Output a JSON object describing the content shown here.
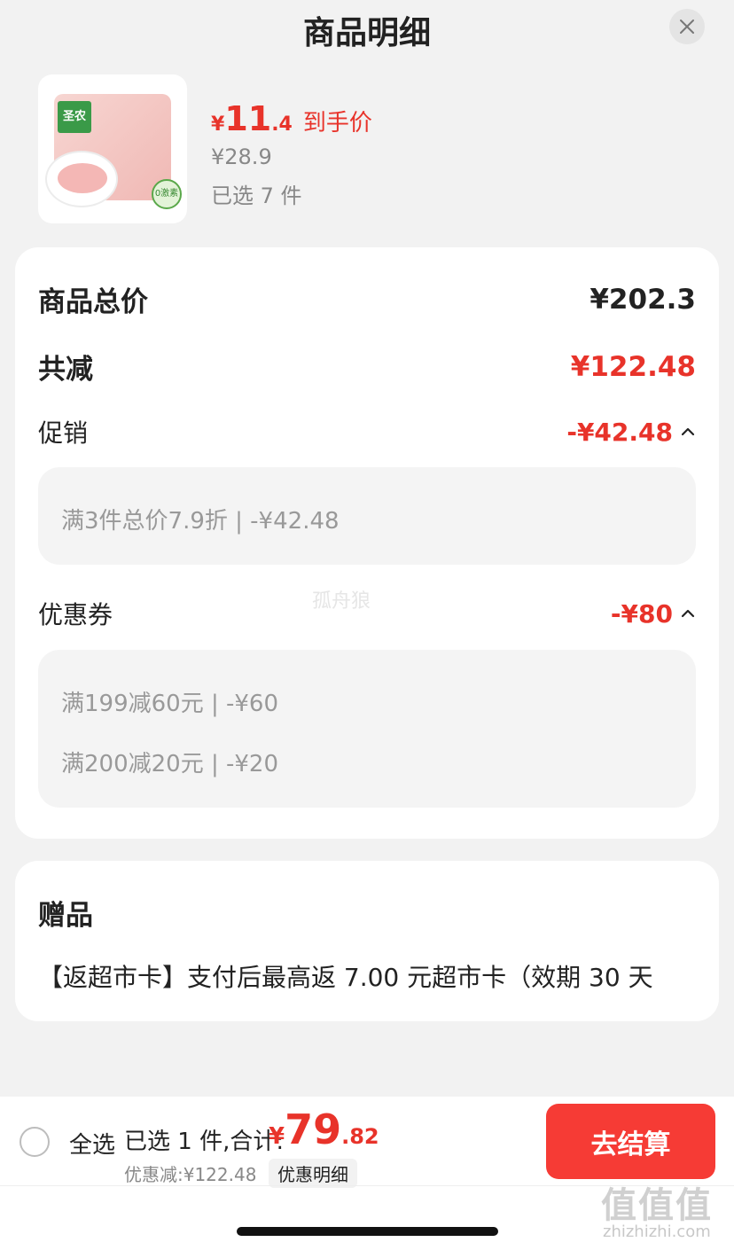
{
  "header": {
    "title": "商品明细"
  },
  "product": {
    "brand": "圣农",
    "seal": "0激素",
    "price_symbol": "¥",
    "price_int": "11",
    "price_dec": ".4",
    "price_tag": "到手价",
    "original_price": "¥28.9",
    "selected": "已选 7 件"
  },
  "breakdown": {
    "total_label": "商品总价",
    "total_value": "¥202.3",
    "reduction_label": "共减",
    "reduction_value": "¥122.48",
    "promo_label": "促销",
    "promo_value": "-¥42.48",
    "promo_items": [
      "满3件总价7.9折 | -¥42.48"
    ],
    "coupon_label": "优惠券",
    "coupon_value": "-¥80",
    "coupon_items": [
      "满199减60元 | -¥60",
      "满200减20元 | -¥20"
    ]
  },
  "watermark": "孤舟狼",
  "gift": {
    "title": "赠品",
    "text": "【返超市卡】支付后最高返 7.00 元超市卡（效期 30 天"
  },
  "bottom": {
    "select_all": "全选",
    "summary_label": "已选 1 件,合计:",
    "sum_symbol": "¥",
    "sum_int": "79",
    "sum_dec": ".82",
    "discount": "优惠减:¥122.48",
    "detail_button": "优惠明细",
    "checkout": "去结算",
    "site_logo": "值值值",
    "site_url": "zhizhizhi.com"
  },
  "colors": {
    "accent": "#e8332a",
    "checkout_bg": "#f63b35"
  }
}
